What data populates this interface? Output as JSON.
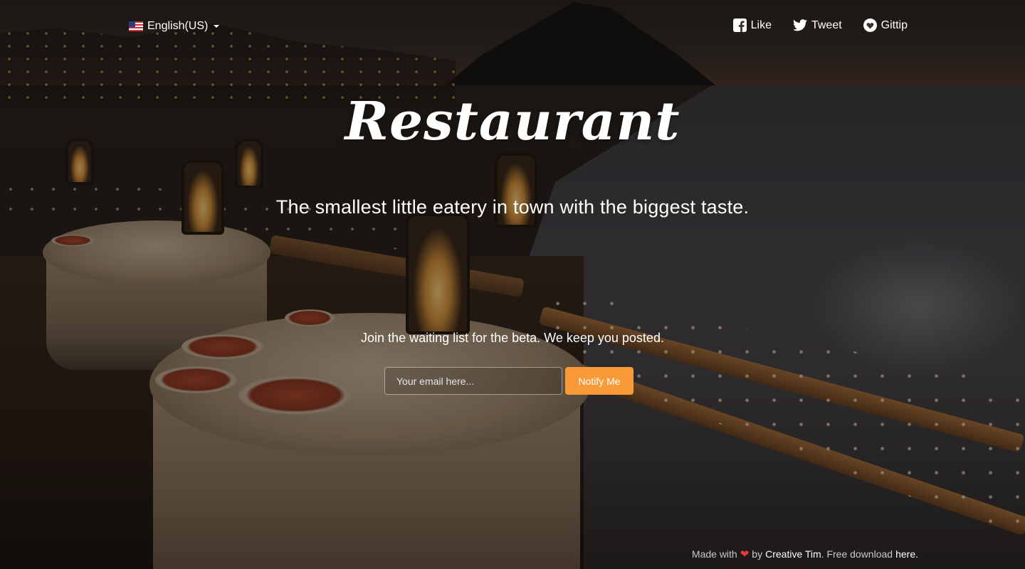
{
  "header": {
    "language": {
      "label": "English(US)",
      "flag_icon": "us-flag-icon"
    },
    "social": [
      {
        "label": "Like",
        "icon": "facebook-icon"
      },
      {
        "label": "Tweet",
        "icon": "twitter-icon"
      },
      {
        "label": "Gittip",
        "icon": "gittip-heart-icon"
      }
    ]
  },
  "hero": {
    "brand": "Restaurant",
    "tagline": "The smallest little eatery in town with the biggest taste."
  },
  "signup": {
    "prompt": "Join the waiting list for the beta. We keep you posted.",
    "email_placeholder": "Your email here...",
    "email_value": "",
    "button_label": "Notify Me"
  },
  "footer": {
    "made_with": "Made with",
    "by": "by",
    "author": "Creative Tim",
    "free_download": ". Free download",
    "here": "here."
  },
  "colors": {
    "accent": "#f89a37",
    "heart": "#e8393b",
    "text": "#ffffff",
    "muted": "#c8c8c8"
  }
}
